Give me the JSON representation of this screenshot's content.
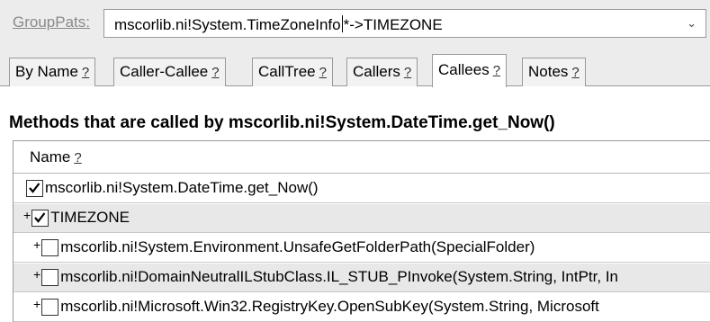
{
  "grouppats": {
    "label": "GroupPats:",
    "value_before_caret": "mscorlib.ni!System.TimeZoneInfo",
    "value_after_caret": "*->TIMEZONE"
  },
  "tabs": [
    {
      "label": "By Name",
      "help": "?"
    },
    {
      "label": "Caller-Callee",
      "help": "?"
    },
    {
      "label": "CallTree",
      "help": "?"
    },
    {
      "label": "Callers",
      "help": "?"
    },
    {
      "label": "Callees",
      "help": "?",
      "active": true
    },
    {
      "label": "Notes",
      "help": "?"
    }
  ],
  "heading": "Methods that are called by mscorlib.ni!System.DateTime.get_Now()",
  "grid": {
    "column_name": "Name",
    "column_help": "?",
    "rows": [
      {
        "expander": "",
        "checked": true,
        "label": "mscorlib.ni!System.DateTime.get_Now()"
      },
      {
        "expander": "+",
        "checked": true,
        "label": "TIMEZONE"
      },
      {
        "expander": "+",
        "checked": false,
        "label": "mscorlib.ni!System.Environment.UnsafeGetFolderPath(SpecialFolder)"
      },
      {
        "expander": "+",
        "checked": false,
        "label": "mscorlib.ni!DomainNeutralILStubClass.IL_STUB_PInvoke(System.String, IntPtr, In"
      },
      {
        "expander": "+",
        "checked": false,
        "label": "mscorlib.ni!Microsoft.Win32.RegistryKey.OpenSubKey(System.String, Microsoft"
      }
    ]
  }
}
